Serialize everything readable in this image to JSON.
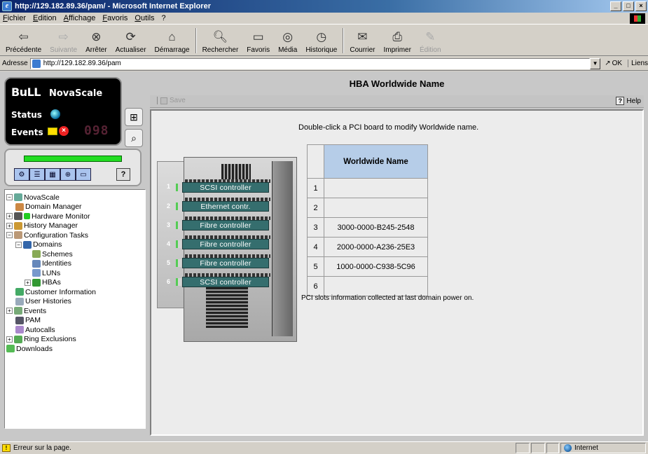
{
  "window": {
    "title": "http://129.182.89.36/pam/ - Microsoft Internet Explorer"
  },
  "menu": [
    "Fichier",
    "Edition",
    "Affichage",
    "Favoris",
    "Outils",
    "?"
  ],
  "toolbar": {
    "back": "Précédente",
    "forward": "Suivante",
    "stop": "Arrêter",
    "refresh": "Actualiser",
    "home": "Démarrage",
    "search": "Rechercher",
    "favorites": "Favoris",
    "media": "Média",
    "history": "Historique",
    "mail": "Courrier",
    "print": "Imprimer",
    "edit": "Édition"
  },
  "address": {
    "label": "Adresse",
    "url": "http://129.182.89.36/pam",
    "go": "OK",
    "links": "Liens"
  },
  "novascale": {
    "brand": "BuLL",
    "product": "NovaScale",
    "status_label": "Status",
    "events_label": "Events",
    "events_count": "098"
  },
  "tree": {
    "items": [
      "NovaScale",
      "Domain Manager",
      "Hardware Monitor",
      "History Manager",
      "Configuration Tasks",
      "Domains",
      "Schemes",
      "Identities",
      "LUNs",
      "HBAs",
      "Customer Information",
      "User Histories",
      "Events",
      "PAM",
      "Autocalls",
      "Ring Exclusions",
      "Downloads"
    ]
  },
  "page": {
    "title": "HBA Worldwide Name",
    "save": "Save",
    "help": "Help",
    "instruction": "Double-click a PCI board to modify Worldwide name.",
    "footnote": "PCI slots information collected at last domain power on."
  },
  "pci": {
    "slots": [
      {
        "num": "1",
        "label": "SCSI controller"
      },
      {
        "num": "2",
        "label": "Ethernet contr."
      },
      {
        "num": "3",
        "label": "Fibre controller"
      },
      {
        "num": "4",
        "label": "Fibre controller"
      },
      {
        "num": "5",
        "label": "Fibre controller"
      },
      {
        "num": "6",
        "label": "SCSI controller"
      }
    ]
  },
  "table": {
    "header": "Worldwide Name",
    "rows": [
      {
        "num": "1",
        "wwn": ""
      },
      {
        "num": "2",
        "wwn": ""
      },
      {
        "num": "3",
        "wwn": "3000-0000-B245-2548"
      },
      {
        "num": "4",
        "wwn": "2000-0000-A236-25E3"
      },
      {
        "num": "5",
        "wwn": "1000-0000-C938-5C96"
      },
      {
        "num": "6",
        "wwn": ""
      }
    ]
  },
  "statusbar": {
    "message": "Erreur sur la page.",
    "zone": "Internet"
  },
  "colors": {
    "pci_card": "#356e6e",
    "table_header": "#b6cde8",
    "status_led": "#22dd22"
  }
}
